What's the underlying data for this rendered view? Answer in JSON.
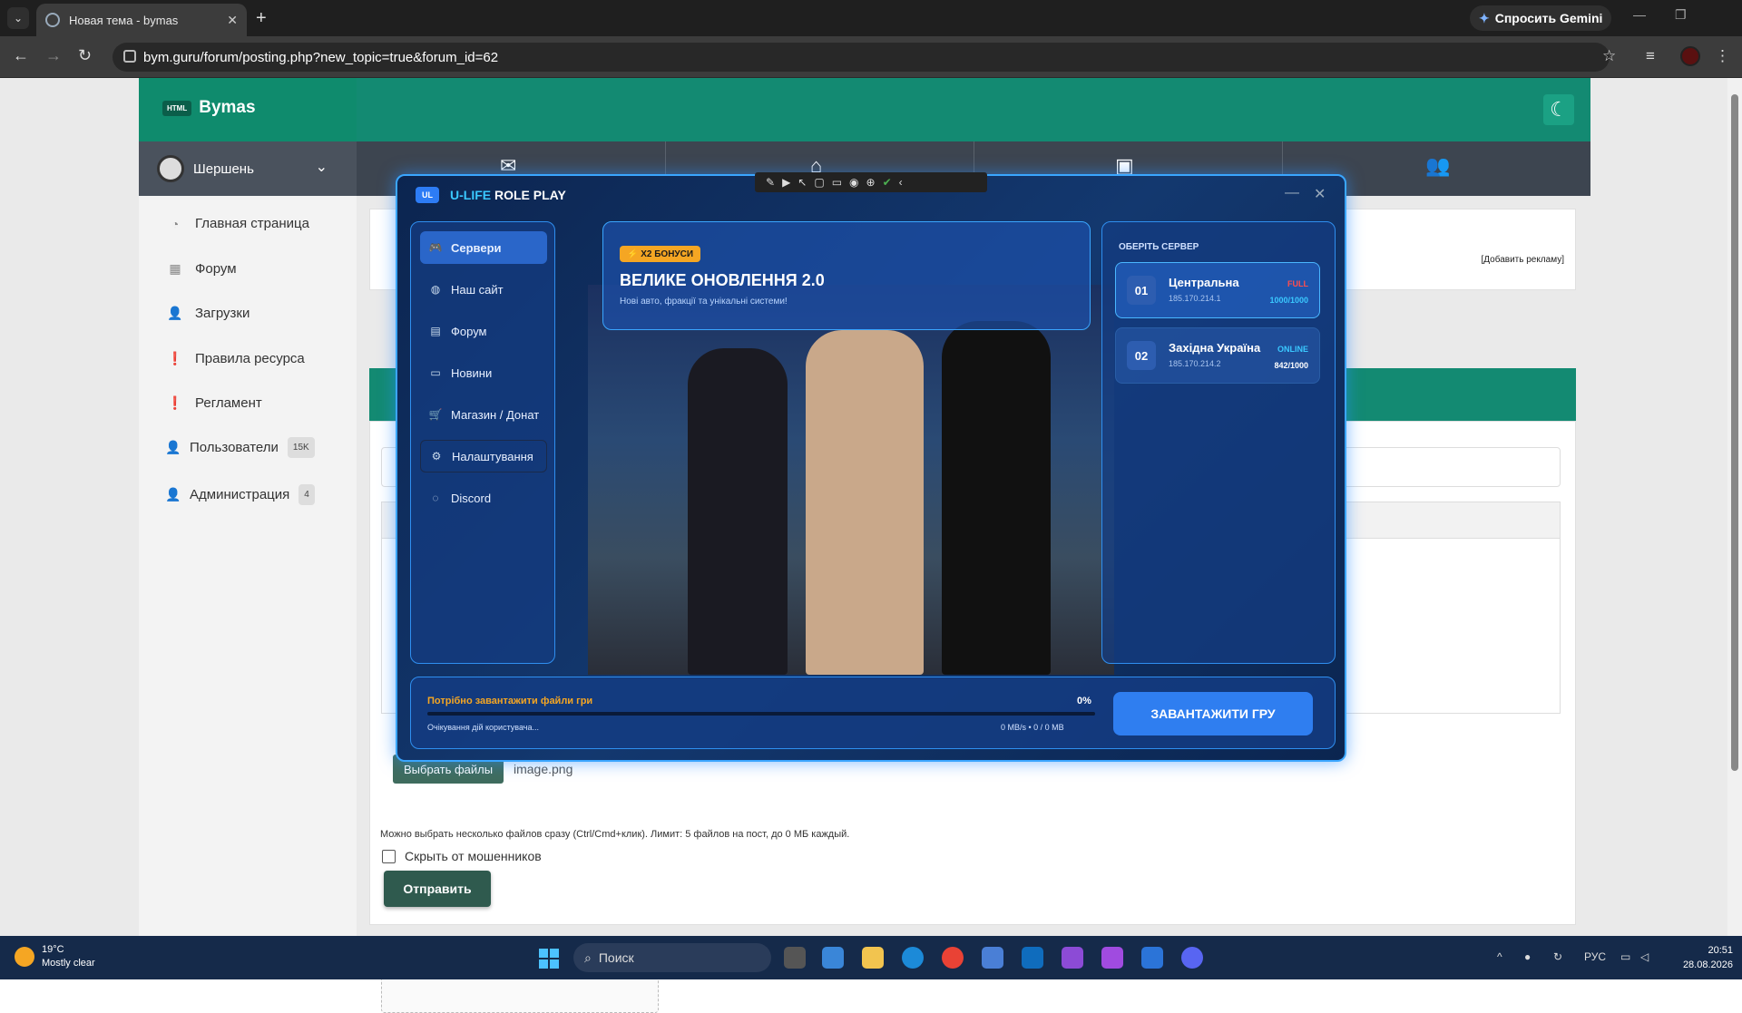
{
  "browser": {
    "tab_title": "Новая тема - bymas",
    "url": "bym.guru/forum/posting.php?new_topic=true&forum_id=62",
    "gemini_label": "Спросить Gemini",
    "icons": [
      "tab-menu-icon",
      "favicon-icon",
      "close-tab-icon",
      "new-tab-icon",
      "back-icon",
      "forward-icon",
      "reload-icon",
      "site-settings-icon",
      "bookmark-star-icon",
      "media-icon",
      "profile-avatar-icon",
      "more-menu-icon",
      "minimize-icon",
      "maximize-icon"
    ]
  },
  "site": {
    "logo_badge": "HTML",
    "logo_text": "Bymas",
    "user_name": "Шершень",
    "sidebar": [
      {
        "label": "Главная страница",
        "icon": "home-icon"
      },
      {
        "label": "Форум",
        "icon": "grid-icon"
      },
      {
        "label": "Загрузки",
        "icon": "users-icon"
      },
      {
        "label": "Правила ресурса",
        "icon": "alert-icon"
      },
      {
        "label": "Регламент",
        "icon": "alert-icon"
      },
      {
        "label": "Пользователи",
        "badge": "15K",
        "icon": "user-icon"
      },
      {
        "label": "Администрация",
        "badge": "4",
        "icon": "user-icon"
      }
    ],
    "ad_link": "[Добавить рекламу]",
    "file_button": "Выбрать файлы",
    "file_name": "image.png",
    "upload_hint": "Можно выбрать несколько файлов сразу (Ctrl/Cmd+клик). Лимит: 5 файлов на пост, до 0 МБ каждый.",
    "hide_label": "Скрыть от мошенников",
    "submit_label": "Отправить"
  },
  "launcher": {
    "logo": "UL",
    "brand_a": "U-LIFE",
    "brand_b": "ROLE PLAY",
    "menu": [
      {
        "label": "Сервери",
        "icon": "gamepad-icon",
        "active": true
      },
      {
        "label": "Наш сайт",
        "icon": "globe-icon"
      },
      {
        "label": "Форум",
        "icon": "document-icon"
      },
      {
        "label": "Новини",
        "icon": "newspaper-icon"
      },
      {
        "label": "Магазин / Донат",
        "icon": "cart-icon"
      },
      {
        "label": "Налаштування",
        "icon": "gear-icon"
      },
      {
        "label": "Discord",
        "icon": "discord-icon"
      }
    ],
    "banner": {
      "badge": "⚡ X2 БОНУСИ",
      "title": "ВЕЛИКЕ ОНОВЛЕННЯ 2.0",
      "subtitle": "Нові авто, фракції та унікальні системи!"
    },
    "servers_title": "ОБЕРІТЬ СЕРВЕР",
    "servers": [
      {
        "num": "01",
        "name": "Центральна",
        "ip": "185.170.214.1",
        "status": "FULL",
        "count": "1000/1000",
        "status_color": "#ff4d4d",
        "count_color": "#3ac8ff"
      },
      {
        "num": "02",
        "name": "Західна Україна",
        "ip": "185.170.214.2",
        "status": "ONLINE",
        "count": "842/1000",
        "status_color": "#3ac8ff",
        "count_color": "#ffffff"
      }
    ],
    "download": {
      "title": "Потрібно завантажити файли гри",
      "percent": "0%",
      "progress": 0,
      "status": "Очікування дій користувача...",
      "speed": "0 MB/s • 0 / 0 MB",
      "button": "ЗАВАНТАЖИТИ ГРУ"
    }
  },
  "taskbar": {
    "temp": "19°C",
    "weather": "Mostly clear",
    "search": "Поиск",
    "lang": "РУС",
    "time": "20:51",
    "date": "28.08.2026"
  },
  "colors": {
    "site_green": "#138a72",
    "launcher_blue": "#2f7ef0",
    "accent_orange": "#f5a623"
  }
}
